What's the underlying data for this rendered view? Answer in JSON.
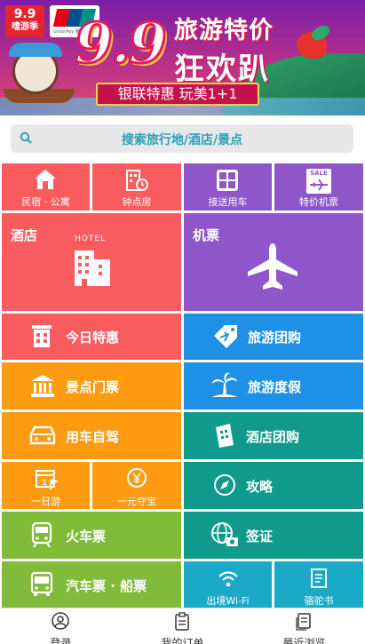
{
  "banner": {
    "logo_top": "9.9",
    "logo_bottom": "嗜游季",
    "unionpay_caption": "UnionPay 银联",
    "big_number": "9.9",
    "slogan_line1": "旅游特价",
    "slogan_line2": "狂欢趴",
    "sub_slogan": "银联特惠 玩美1+1"
  },
  "search": {
    "placeholder": "搜索旅行地/酒店/景点"
  },
  "tiles": {
    "minsu": "民宿 · 公寓",
    "hourly_room": "钟点房",
    "airport_transfer": "接送用车",
    "cheap_flights": "特价机票",
    "sale_badge": "SALE",
    "hotel": "酒店",
    "hotel_sign": "HOTEL",
    "flights": "机票",
    "today_deals": "今日特惠",
    "group_tour": "旅游团购",
    "tickets": "景点门票",
    "vacation": "旅游度假",
    "car_rental": "用车自驾",
    "hotel_group": "酒店团购",
    "one_day_tour": "一日游",
    "one_yuan": "一元夺宝",
    "guides": "攻略",
    "train": "火车票",
    "visa": "签证",
    "bus_ship": "汽车票 · 船票",
    "wifi": "出境Wi-Fi",
    "camel_book": "骆驼书"
  },
  "bottom_nav": {
    "login": "登录",
    "my_orders": "我的订单",
    "recent": "最近浏览"
  },
  "colors": {
    "red": "#f85c5f",
    "purple": "#8e56c8",
    "blue": "#1e90e6",
    "orange": "#fe9b13",
    "teal": "#109a8b",
    "green": "#80bb3a",
    "cyan": "#1aa9c7",
    "search_text": "#2a9fb8"
  }
}
